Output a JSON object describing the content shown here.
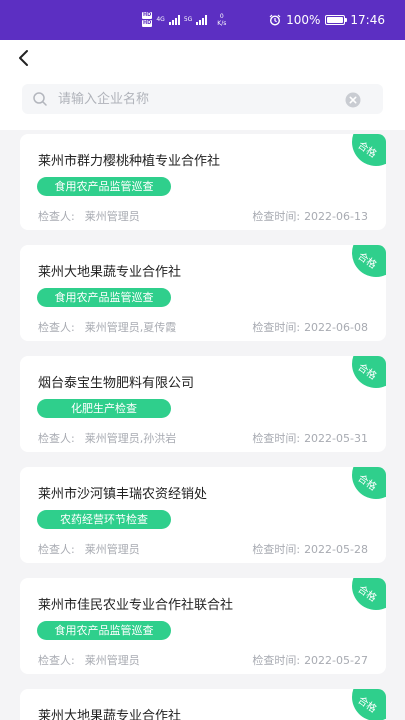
{
  "status_bar": {
    "hd_top": "HD",
    "hd_bottom": "HD",
    "net_1": "4G",
    "net_2": "5G",
    "speed_value": "0",
    "speed_unit": "K/s",
    "battery_percent": "100%",
    "time": "17:46"
  },
  "search": {
    "placeholder": "请输入企业名称",
    "value": ""
  },
  "labels": {
    "inspector": "检查人:",
    "check_time": "检查时间:",
    "pass": "合格"
  },
  "records": [
    {
      "company": "莱州市群力樱桃种植专业合作社",
      "type": "食用农产品监管巡查",
      "inspector": "莱州管理员",
      "date": "2022-06-13"
    },
    {
      "company": "莱州大地果蔬专业合作社",
      "type": "食用农产品监管巡查",
      "inspector": "莱州管理员,夏传霞",
      "date": "2022-06-08"
    },
    {
      "company": "烟台泰宝生物肥料有限公司",
      "type": "化肥生产检查",
      "inspector": "莱州管理员,孙洪岩",
      "date": "2022-05-31"
    },
    {
      "company": "莱州市沙河镇丰瑞农资经销处",
      "type": "农药经营环节检查",
      "inspector": "莱州管理员",
      "date": "2022-05-28"
    },
    {
      "company": "莱州市佳民农业专业合作社联合社",
      "type": "食用农产品监管巡查",
      "inspector": "莱州管理员",
      "date": "2022-05-27"
    },
    {
      "company": "莱州大地果蔬专业合作社",
      "type": "",
      "inspector": "",
      "date": ""
    }
  ]
}
